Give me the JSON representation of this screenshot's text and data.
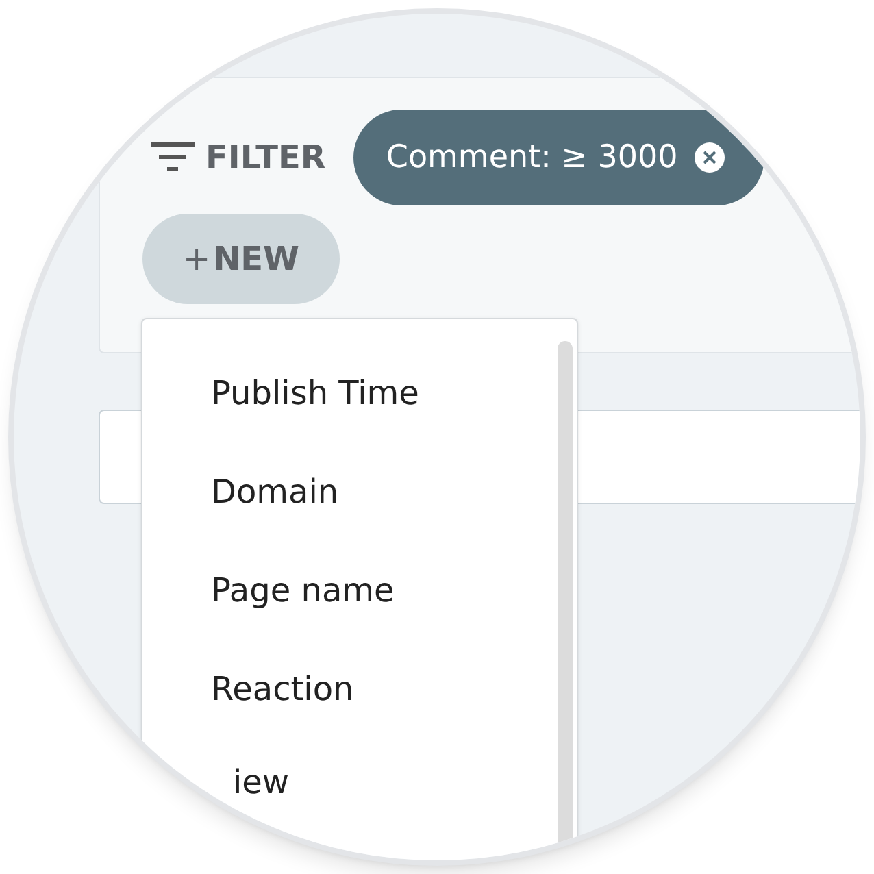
{
  "filter": {
    "label": "FILTER"
  },
  "chips": [
    {
      "label": "Comment: ≥ 3000"
    }
  ],
  "new_button": {
    "plus": "+",
    "label": "NEW"
  },
  "menu": {
    "items": [
      {
        "label": "Publish Time"
      },
      {
        "label": "Domain"
      },
      {
        "label": "Page name"
      },
      {
        "label": "Reaction"
      },
      {
        "label": "iew"
      }
    ]
  }
}
